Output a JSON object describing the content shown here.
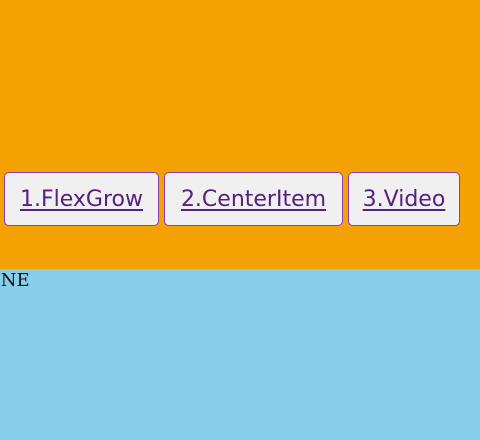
{
  "nav": {
    "items": [
      {
        "label": "1.FlexGrow"
      },
      {
        "label": "2.CenterItem"
      },
      {
        "label": "3.Video"
      }
    ]
  },
  "content": {
    "text": "ONE"
  },
  "colors": {
    "top_band": "#f3a103",
    "bottom_band": "#87ceeb",
    "button_bg": "#f0f0f0",
    "button_border": "#8e3fb1",
    "link_text": "#56207f"
  }
}
